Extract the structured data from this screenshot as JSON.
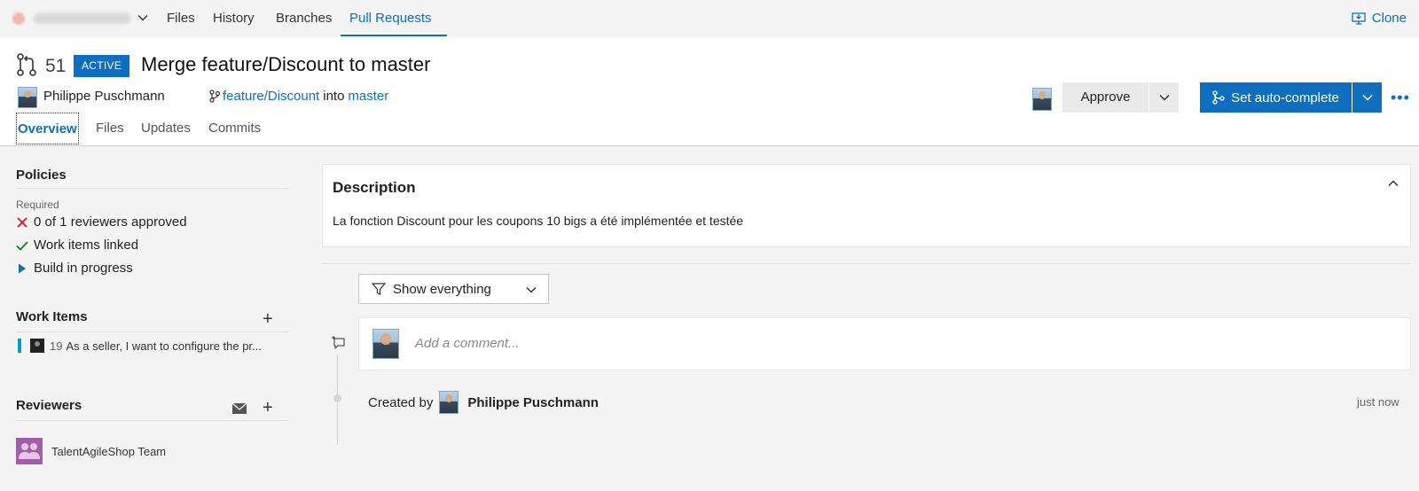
{
  "topnav": {
    "tabs": [
      "Files",
      "History",
      "Branches",
      "Pull Requests"
    ],
    "active_tab": "Pull Requests",
    "clone_label": "Clone"
  },
  "pr": {
    "number": "51",
    "status": "ACTIVE",
    "title": "Merge feature/Discount to master",
    "author": "Philippe Puschmann",
    "source_branch": "feature/Discount",
    "into_text": "into",
    "target_branch": "master"
  },
  "actions": {
    "approve_label": "Approve",
    "autocomplete_label": "Set auto-complete",
    "more_label": "•••"
  },
  "subtabs": [
    "Overview",
    "Files",
    "Updates",
    "Commits"
  ],
  "policies": {
    "title": "Policies",
    "required_label": "Required",
    "items": [
      {
        "status": "failed",
        "label": "0 of 1 reviewers approved"
      },
      {
        "status": "passed",
        "label": "Work items linked"
      },
      {
        "status": "running",
        "label": "Build in progress"
      }
    ]
  },
  "work_items": {
    "title": "Work Items",
    "items": [
      {
        "id": "19",
        "title": "As a seller, I want to configure the pr..."
      }
    ]
  },
  "reviewers": {
    "title": "Reviewers",
    "items": [
      {
        "name": "TalentAgileShop Team"
      }
    ]
  },
  "description": {
    "title": "Description",
    "text": "La fonction Discount pour les coupons 10 bigs a été implémentée et testée"
  },
  "filter": {
    "label": "Show everything"
  },
  "comment": {
    "placeholder": "Add a comment..."
  },
  "timeline": {
    "created_prefix": "Created by",
    "created_by": "Philippe Puschmann",
    "time": "just now"
  },
  "colors": {
    "accent": "#106ebe",
    "failed": "#e81123",
    "passed": "#107c10",
    "team": "#a25fa8"
  }
}
